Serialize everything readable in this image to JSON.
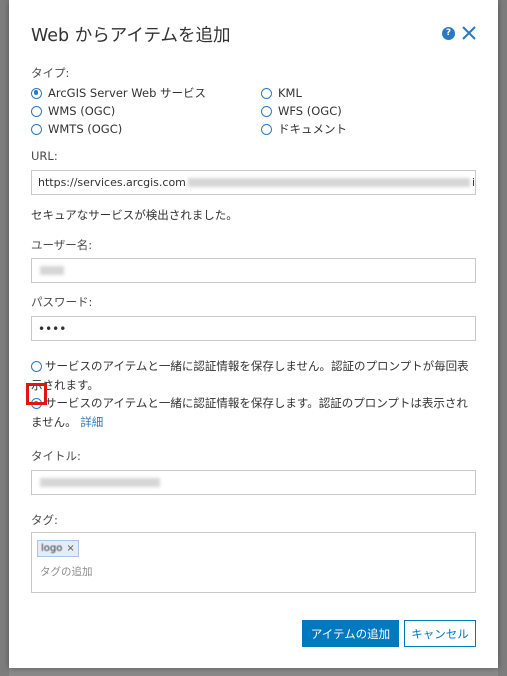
{
  "dialog": {
    "title": "Web からアイテムを追加",
    "help_icon_glyph": "?",
    "close_icon": "close-icon"
  },
  "type_section": {
    "label": "タイプ:",
    "options": [
      {
        "label": "ArcGIS Server Web サービス",
        "checked": true
      },
      {
        "label": "KML",
        "checked": false
      },
      {
        "label": "WMS (OGC)",
        "checked": false
      },
      {
        "label": "WFS (OGC)",
        "checked": false
      },
      {
        "label": "WMTS (OGC)",
        "checked": false
      },
      {
        "label": "ドキュメント",
        "checked": false
      }
    ]
  },
  "url": {
    "label": "URL:",
    "value_visible": "https://services.arcgis.com",
    "value_tail": "i"
  },
  "secure_message": "セキュアなサービスが検出されました。",
  "username": {
    "label": "ユーザー名:"
  },
  "password": {
    "label": "パスワード:",
    "value": "••••"
  },
  "credential_options": {
    "no_store": {
      "text": "サービスのアイテムと一緒に認証情報を保存しません。認証のプロンプトが毎回表示されます。",
      "checked": false
    },
    "store": {
      "text": "サービスのアイテムと一緒に認証情報を保存します。認証のプロンプトは表示されません。",
      "link": "詳細",
      "checked": true
    }
  },
  "title_field": {
    "label": "タイトル:"
  },
  "tags": {
    "label": "タグ:",
    "chips": [
      {
        "text": "logo",
        "remove_glyph": "×"
      }
    ],
    "placeholder": "タグの追加"
  },
  "buttons": {
    "add": "アイテムの追加",
    "cancel": "キャンセル"
  },
  "colors": {
    "accent": "#0079c1",
    "highlight": "#e11313"
  }
}
